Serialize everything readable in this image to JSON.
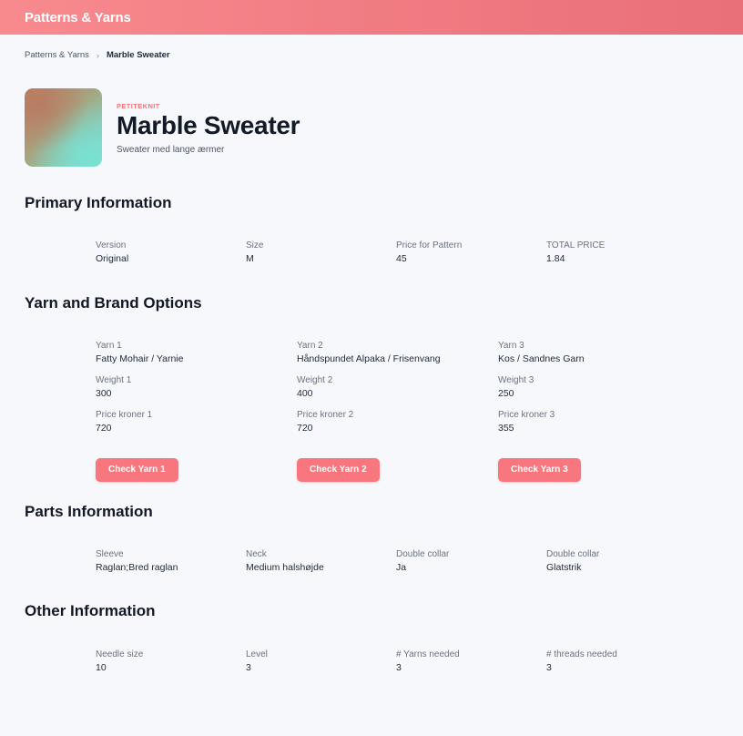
{
  "app": {
    "title": "Patterns & Yarns"
  },
  "breadcrumb": {
    "root": "Patterns & Yarns",
    "separator": "›",
    "current": "Marble Sweater"
  },
  "pattern": {
    "brand": "PETITEKNIT",
    "title": "Marble Sweater",
    "subtitle": "Sweater med lange ærmer"
  },
  "primary": {
    "title": "Primary Information",
    "fields": [
      {
        "label": "Version",
        "value": "Original"
      },
      {
        "label": "Size",
        "value": "M"
      },
      {
        "label": "Price for Pattern",
        "value": "45"
      },
      {
        "label": "TOTAL PRICE",
        "value": "1.84"
      }
    ]
  },
  "yarns": {
    "title": "Yarn and Brand Options",
    "columns": [
      {
        "yarn_label": "Yarn 1",
        "yarn_value": "Fatty Mohair / Yarnie",
        "weight_label": "Weight 1",
        "weight_value": "300",
        "price_label": "Price kroner 1",
        "price_value": "720",
        "button": "Check Yarn 1"
      },
      {
        "yarn_label": "Yarn 2",
        "yarn_value": "Håndspundet Alpaka / Frisenvang",
        "weight_label": "Weight 2",
        "weight_value": "400",
        "price_label": "Price kroner 2",
        "price_value": "720",
        "button": "Check Yarn 2"
      },
      {
        "yarn_label": "Yarn 3",
        "yarn_value": "Kos / Sandnes Garn",
        "weight_label": "Weight 3",
        "weight_value": "250",
        "price_label": "Price kroner 3",
        "price_value": "355",
        "button": "Check Yarn 3"
      }
    ]
  },
  "parts": {
    "title": "Parts Information",
    "fields": [
      {
        "label": "Sleeve",
        "value": "Raglan;Bred raglan"
      },
      {
        "label": "Neck",
        "value": "Medium halshøjde"
      },
      {
        "label": "Double collar",
        "value": "Ja"
      },
      {
        "label": "Double collar",
        "value": "Glatstrik"
      }
    ]
  },
  "other": {
    "title": "Other Information",
    "fields": [
      {
        "label": "Needle size",
        "value": "10"
      },
      {
        "label": "Level",
        "value": "3"
      },
      {
        "label": "# Yarns needed",
        "value": "3"
      },
      {
        "label": "# threads needed",
        "value": "3"
      }
    ]
  }
}
